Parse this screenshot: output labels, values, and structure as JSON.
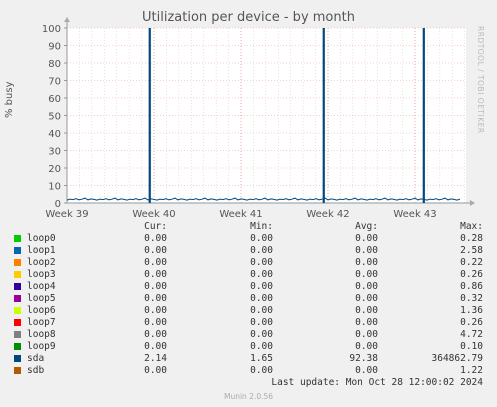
{
  "title": "Utilization per device - by month",
  "side_text": "RRDTOOL / TOBI OETIKER",
  "update_text": "Last update: Mon Oct 28 12:00:02 2024",
  "footer_text": "Munin 2.0.56",
  "legend_headers": {
    "cur": "Cur:",
    "min": "Min:",
    "avg": "Avg:",
    "max": "Max:"
  },
  "chart_data": {
    "type": "line",
    "title": "Utilization per device - by month",
    "ylabel": "% busy",
    "ylim": [
      0,
      100
    ],
    "yticks": [
      0,
      10,
      20,
      30,
      40,
      50,
      60,
      70,
      80,
      90,
      100
    ],
    "xticks": [
      "Week 39",
      "Week 40",
      "Week 41",
      "Week 42",
      "Week 43"
    ],
    "grid": true,
    "series": [
      {
        "name": "loop0",
        "color": "#00cc00",
        "cur": "0.00",
        "min": "0.00",
        "avg": "0.00",
        "max": "0.28"
      },
      {
        "name": "loop1",
        "color": "#0066b3",
        "cur": "0.00",
        "min": "0.00",
        "avg": "0.00",
        "max": "2.58"
      },
      {
        "name": "loop2",
        "color": "#ff8000",
        "cur": "0.00",
        "min": "0.00",
        "avg": "0.00",
        "max": "0.22"
      },
      {
        "name": "loop3",
        "color": "#ffcc00",
        "cur": "0.00",
        "min": "0.00",
        "avg": "0.00",
        "max": "0.26"
      },
      {
        "name": "loop4",
        "color": "#330099",
        "cur": "0.00",
        "min": "0.00",
        "avg": "0.00",
        "max": "0.86"
      },
      {
        "name": "loop5",
        "color": "#990099",
        "cur": "0.00",
        "min": "0.00",
        "avg": "0.00",
        "max": "0.32"
      },
      {
        "name": "loop6",
        "color": "#ccff00",
        "cur": "0.00",
        "min": "0.00",
        "avg": "0.00",
        "max": "1.36"
      },
      {
        "name": "loop7",
        "color": "#ff0000",
        "cur": "0.00",
        "min": "0.00",
        "avg": "0.00",
        "max": "0.26"
      },
      {
        "name": "loop8",
        "color": "#808080",
        "cur": "0.00",
        "min": "0.00",
        "avg": "0.00",
        "max": "4.72"
      },
      {
        "name": "loop9",
        "color": "#008f00",
        "cur": "0.00",
        "min": "0.00",
        "avg": "0.00",
        "max": "0.10"
      },
      {
        "name": "sda",
        "color": "#00487d",
        "cur": "2.14",
        "min": "1.65",
        "avg": "92.38",
        "max": "364862.79",
        "spikes_at_week": [
          39.95,
          41.95,
          43.1
        ],
        "baseline": 2
      },
      {
        "name": "sdb",
        "color": "#b35a00",
        "cur": "0.00",
        "min": "0.00",
        "avg": "0.00",
        "max": "1.22"
      }
    ]
  }
}
